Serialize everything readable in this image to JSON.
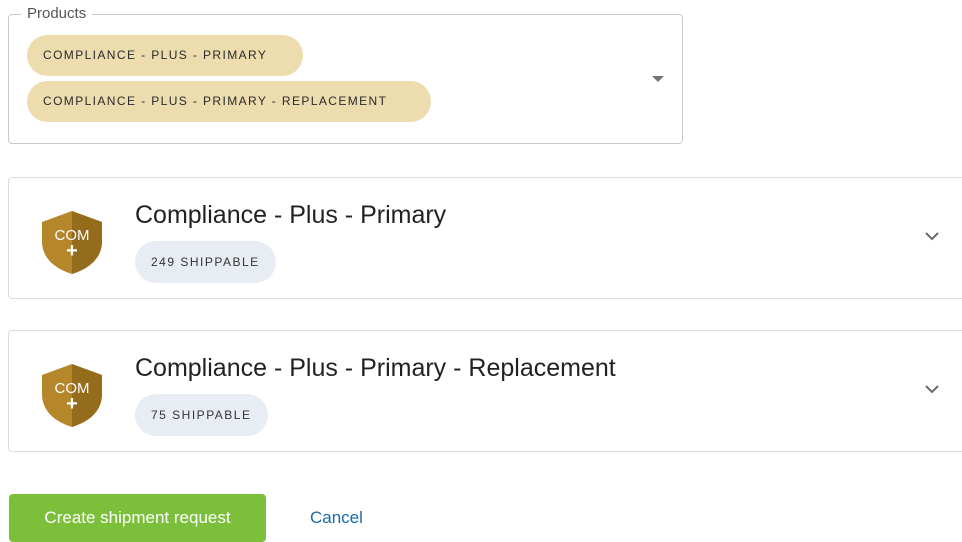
{
  "products_field": {
    "label": "Products",
    "selected": [
      "COMPLIANCE - PLUS - PRIMARY",
      "COMPLIANCE - PLUS - PRIMARY - REPLACEMENT"
    ]
  },
  "cards": [
    {
      "title": "Compliance - Plus - Primary",
      "badge": "249 SHIPPABLE",
      "icon_text": "COM",
      "icon_symbol": "+",
      "icon": "shield-icon"
    },
    {
      "title": "Compliance - Plus - Primary - Replacement",
      "badge": "75 SHIPPABLE",
      "icon_text": "COM",
      "icon_symbol": "+",
      "icon": "shield-icon"
    }
  ],
  "actions": {
    "create": "Create shipment request",
    "cancel": "Cancel"
  },
  "colors": {
    "chip": "#ecdcae",
    "shield_gold": "#b5862a",
    "shield_dark": "#7a5510",
    "badge": "#e8edf3",
    "primary_button": "#7cbf3b",
    "link": "#1a6aa8"
  }
}
